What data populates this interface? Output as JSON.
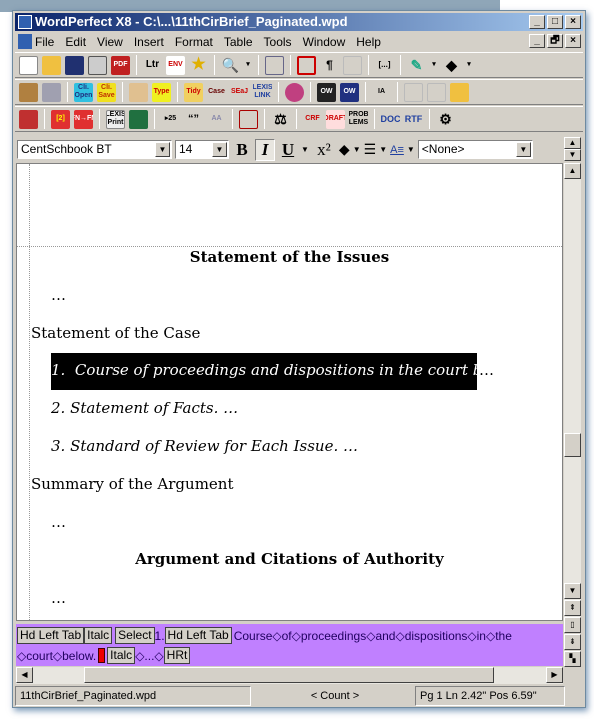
{
  "window": {
    "title": "WordPerfect X8 - C:\\...\\11thCirBrief_Paginated.wpd",
    "controls": [
      "_",
      "□",
      "×"
    ],
    "doc_controls": [
      "_",
      "🗗",
      "×"
    ]
  },
  "menu": [
    "File",
    "Edit",
    "View",
    "Insert",
    "Format",
    "Table",
    "Tools",
    "Window",
    "Help"
  ],
  "toolbar1": [
    "new",
    "open",
    "save",
    "print",
    "PDF",
    "Ltr",
    "ENV",
    "★",
    "zoom",
    "▾",
    "select",
    "insert",
    "show",
    "[...]",
    "highlight",
    "▾",
    "fill",
    "▾"
  ],
  "toolbar2": [
    "open2",
    "save2",
    "Cli. Open",
    "Cli. Save",
    "paste",
    "Type",
    "Tidy",
    "Case",
    "SEaJ",
    "LEXIS LINK",
    "block",
    "OW",
    "OW",
    "IA",
    "doc1",
    "doc2",
    "export"
  ],
  "toolbar3": [
    "book",
    "[2]",
    "FN→FN",
    "LEXIS Print",
    "table",
    "▸25",
    "“”",
    "AA",
    "shape",
    "⚖",
    "CRF",
    "DRAFT",
    "PROB LEMS",
    "DOC",
    "RTF",
    "tools"
  ],
  "propbar": {
    "font": "CentSchbook BT",
    "size": "14",
    "bold": "B",
    "italic": "I",
    "underline": "U",
    "superscript": "x²",
    "style": "<None>"
  },
  "document": {
    "heading1": "Statement of the Issues",
    "ell1": "…",
    "case": "Statement of the Case",
    "item1_num": "1.",
    "item1": "Course of proceedings and dispositions in the court below.",
    "item1_tail": " …",
    "item2": "2.  Statement of Facts. …",
    "item3": "3.  Standard of Review for Each Issue. …",
    "summary": "Summary of the Argument",
    "ell2": "…",
    "heading2": "Argument and Citations of Authority",
    "ell3": "…"
  },
  "reveal": {
    "line1": [
      "Hd Left Tab",
      "Italc",
      "Select",
      "1.",
      "Hd Left Tab",
      "Course◇of◇proceedings◇and◇dispositions◇in◇the"
    ],
    "line2": [
      "◇court◇below.",
      "Italc",
      "◇...◇",
      "HRt"
    ]
  },
  "status": {
    "file": "11thCirBrief_Paginated.wpd",
    "count": "< Count >",
    "position": "Pg 1 Ln 2.42\" Pos 6.59\""
  },
  "colors": {
    "reveal_bg": "#c080ff",
    "titlebar": "#0a246a",
    "selection": "#000000"
  }
}
